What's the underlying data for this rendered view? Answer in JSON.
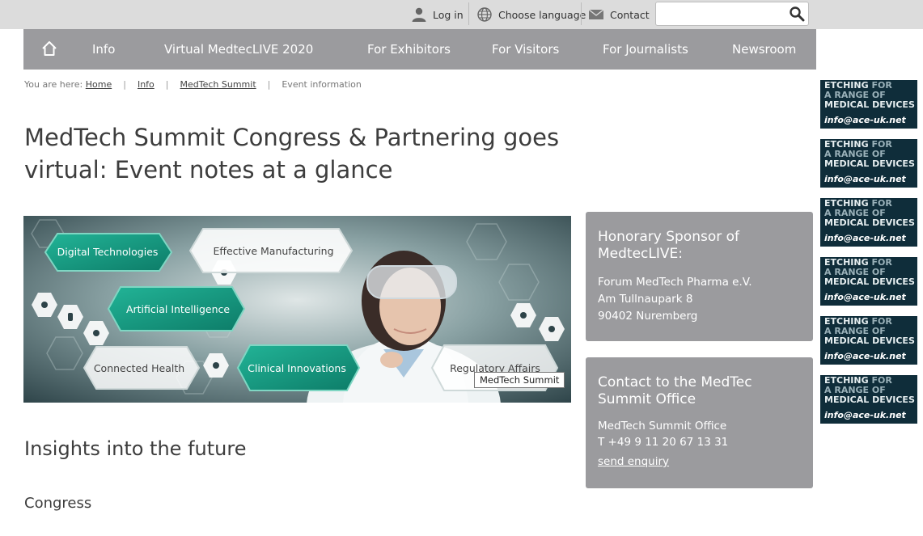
{
  "utility": {
    "login": "Log in",
    "language": "Choose language",
    "contact": "Contact",
    "search_placeholder": ""
  },
  "nav": {
    "items": [
      "Info",
      "Virtual MedtecLIVE 2020",
      "For Exhibitors",
      "For Visitors",
      "For Journalists",
      "Newsroom"
    ]
  },
  "breadcrumb": {
    "prefix": "You are here:",
    "items": [
      "Home",
      "Info",
      "MedTech Summit",
      "Event information"
    ]
  },
  "page": {
    "title": "MedTech Summit Congress & Partnering goes virtual: Event notes at a glance",
    "hero_tooltip": "MedTech Summit",
    "hero_labels": [
      "Digital Technologies",
      "Effective Manufacturing",
      "Artificial Intelligence",
      "Connected Health",
      "Clinical Innovations",
      "Regulatory Affairs"
    ],
    "section_heading": "Insights into the future",
    "subheading": "Congress"
  },
  "sponsor_box": {
    "title": "Honorary Sponsor of MedtecLIVE:",
    "lines": [
      "Forum MedTech Pharma e.V.",
      "Am Tullnaupark 8",
      "90402 Nuremberg"
    ]
  },
  "contact_box": {
    "title": "Contact to the MedTec Summit Office",
    "lines": [
      "MedTech Summit Office",
      "T +49 9 11 20 67 13 31"
    ],
    "link": "send enquiry"
  },
  "ad": {
    "line1_a": "ETCHING ",
    "line1_b": "FOR",
    "line2": "A RANGE OF",
    "line3": "MEDICAL DEVICES",
    "line4": "info@ace-uk.net"
  },
  "colors": {
    "nav_bg": "#9b9b9e",
    "topbar_bg": "#dcdcdc",
    "ad_bg": "#0f2d3a",
    "teal": "#1a9c85"
  }
}
